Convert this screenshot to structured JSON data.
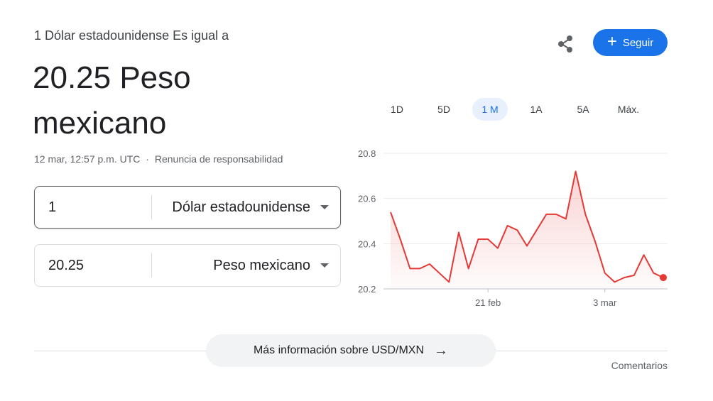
{
  "header": {
    "subtitle": "1 Dólar estadounidense Es igual a",
    "result": "20.25 Peso mexicano",
    "timestamp": "12 mar, 12:57 p.m. UTC",
    "separator": "·",
    "disclaimer": "Renuncia de responsabilidad"
  },
  "actions": {
    "share_icon": "share-icon",
    "follow_label": "Seguir",
    "follow_icon": "+"
  },
  "converter": {
    "from": {
      "amount": "1",
      "currency": "Dólar estadounidense"
    },
    "to": {
      "amount": "20.25",
      "currency": "Peso mexicano"
    }
  },
  "range_tabs": [
    "1D",
    "5D",
    "1 M",
    "1A",
    "5A",
    "Máx."
  ],
  "selected_tab": "1 M",
  "footer": {
    "more_info_label": "Más información sobre USD/MXN",
    "arrow_icon": "→",
    "feedback_label": "Comentarios"
  },
  "colors": {
    "accent": "#1a73e8",
    "line": "#e53935",
    "fill": "#fde7e7"
  },
  "chart_data": {
    "type": "line",
    "title": "",
    "xlabel": "",
    "ylabel": "",
    "x_ticks": [
      {
        "label": "21 feb",
        "index": 10
      },
      {
        "label": "3 mar",
        "index": 22
      }
    ],
    "y_ticks": [
      "20.8",
      "20.6",
      "20.4",
      "20.2"
    ],
    "y_tick_values": [
      20.8,
      20.6,
      20.4,
      20.2
    ],
    "ylim": [
      20.2,
      20.8
    ],
    "grid": true,
    "series": [
      {
        "values": [
          20.54,
          20.42,
          20.29,
          20.29,
          20.31,
          20.27,
          20.23,
          20.45,
          20.29,
          20.42,
          20.42,
          20.38,
          20.48,
          20.46,
          20.39,
          20.46,
          20.53,
          20.53,
          20.51,
          20.72,
          20.53,
          20.41,
          20.27,
          20.23,
          20.25,
          20.26,
          20.35,
          20.27,
          20.25
        ]
      }
    ]
  }
}
